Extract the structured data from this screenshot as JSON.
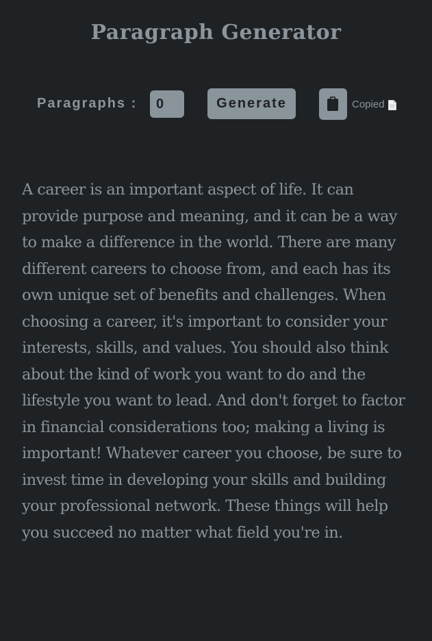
{
  "header": {
    "title": "Paragraph Generator"
  },
  "controls": {
    "paragraphs_label": "Paragraphs :",
    "paragraph_count": "0",
    "generate_label": "Generate",
    "copy_icon": "clipboard-icon",
    "copied_status": "Copied",
    "copied_icon": "document-icon"
  },
  "output": {
    "text": "A career is an important aspect of life. It can provide purpose and meaning, and it can be a way to make a difference in the world. There are many different careers to choose from, and each has its own unique set of benefits and challenges. When choosing a career, it's important to consider your interests, skills, and values. You should also think about the kind of work you want to do and the lifestyle you want to lead. And don't forget to factor in financial considerations too; making a living is important! Whatever career you choose, be sure to invest time in developing your skills and building your professional network. These things will help you succeed no matter what field you're in."
  },
  "colors": {
    "background": "#1f2225",
    "text": "#8c959c",
    "button": "#8a949b",
    "button_text": "#1f2225"
  }
}
